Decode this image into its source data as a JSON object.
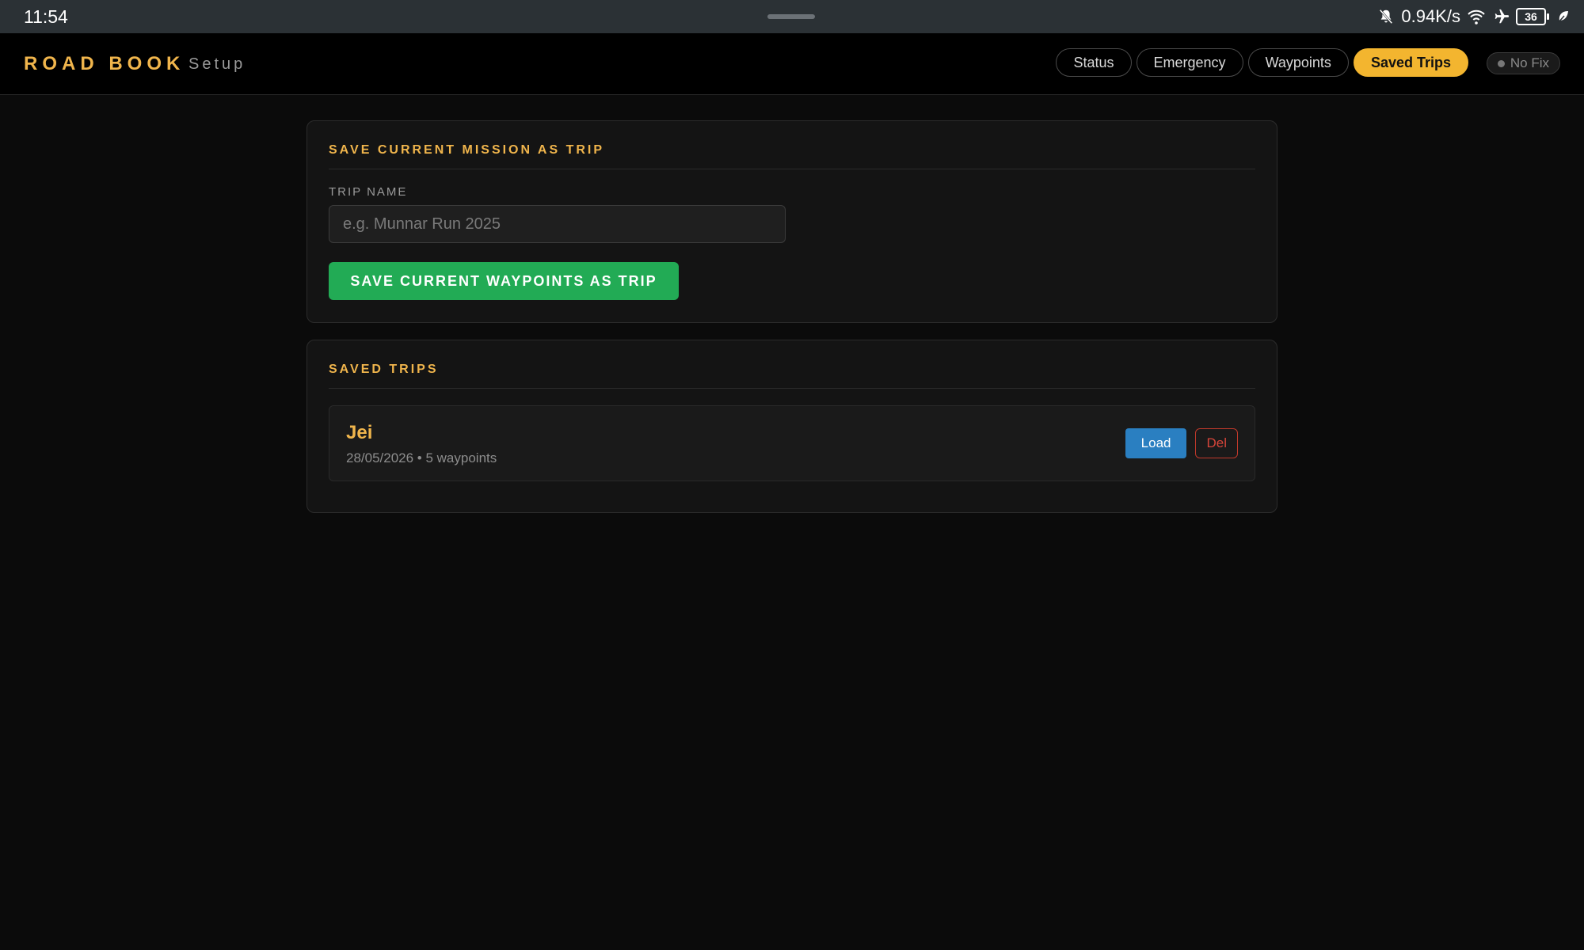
{
  "system_bar": {
    "time": "11:54",
    "net_speed": "0.94K/s",
    "battery": "36",
    "icons": [
      "bell-off-icon",
      "wifi-icon",
      "airplane-icon",
      "battery-icon",
      "leaf-icon"
    ]
  },
  "header": {
    "brand": "ROAD BOOK",
    "subtitle": "Setup",
    "nav": [
      "Status",
      "Emergency",
      "Waypoints",
      "Saved Trips"
    ],
    "active_nav": "Saved Trips",
    "gps_status": "No Fix"
  },
  "save_section": {
    "title": "SAVE CURRENT MISSION AS TRIP",
    "field_label": "TRIP NAME",
    "trip_name_value": "",
    "trip_name_placeholder": "e.g. Munnar Run 2025",
    "save_button": "SAVE CURRENT WAYPOINTS AS TRIP"
  },
  "saved_section": {
    "title": "SAVED TRIPS",
    "trips": [
      {
        "name": "Jei",
        "meta": "28/05/2026 • 5 waypoints",
        "load_label": "Load",
        "delete_label": "Del"
      }
    ]
  },
  "colors": {
    "accent": "#f0b54c",
    "active_tab": "#f3b52f",
    "save_button": "#22ab55",
    "load_button": "#2a7fc1",
    "delete_button": "#c0392b"
  }
}
